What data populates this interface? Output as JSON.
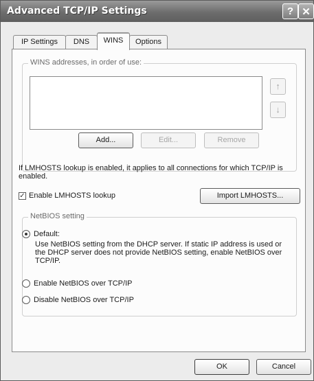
{
  "window": {
    "title": "Advanced TCP/IP Settings",
    "help_glyph": "?",
    "close_glyph": "✕"
  },
  "tabs": [
    {
      "label": "IP Settings",
      "active": false
    },
    {
      "label": "DNS",
      "active": false
    },
    {
      "label": "WINS",
      "active": true
    },
    {
      "label": "Options",
      "active": false
    }
  ],
  "wins": {
    "group_title": "WINS addresses, in order of use:",
    "move_up_glyph": "↑",
    "move_down_glyph": "↓",
    "add_label": "Add...",
    "edit_label": "Edit...",
    "remove_label": "Remove",
    "lmhosts_info": "If LMHOSTS lookup is enabled, it applies to all connections for which TCP/IP is enabled.",
    "enable_lmhosts_label": "Enable LMHOSTS lookup",
    "enable_lmhosts_checked": true,
    "check_glyph": "✓",
    "import_label": "Import LMHOSTS..."
  },
  "netbios": {
    "group_title": "NetBIOS setting",
    "default_label": "Default:",
    "default_description": "Use NetBIOS setting from the DHCP server. If static IP address is used or the DHCP server does not provide NetBIOS setting, enable NetBIOS over TCP/IP.",
    "enable_label": "Enable NetBIOS over TCP/IP",
    "disable_label": "Disable NetBIOS over TCP/IP",
    "selected": "default"
  },
  "footer": {
    "ok_label": "OK",
    "cancel_label": "Cancel"
  }
}
